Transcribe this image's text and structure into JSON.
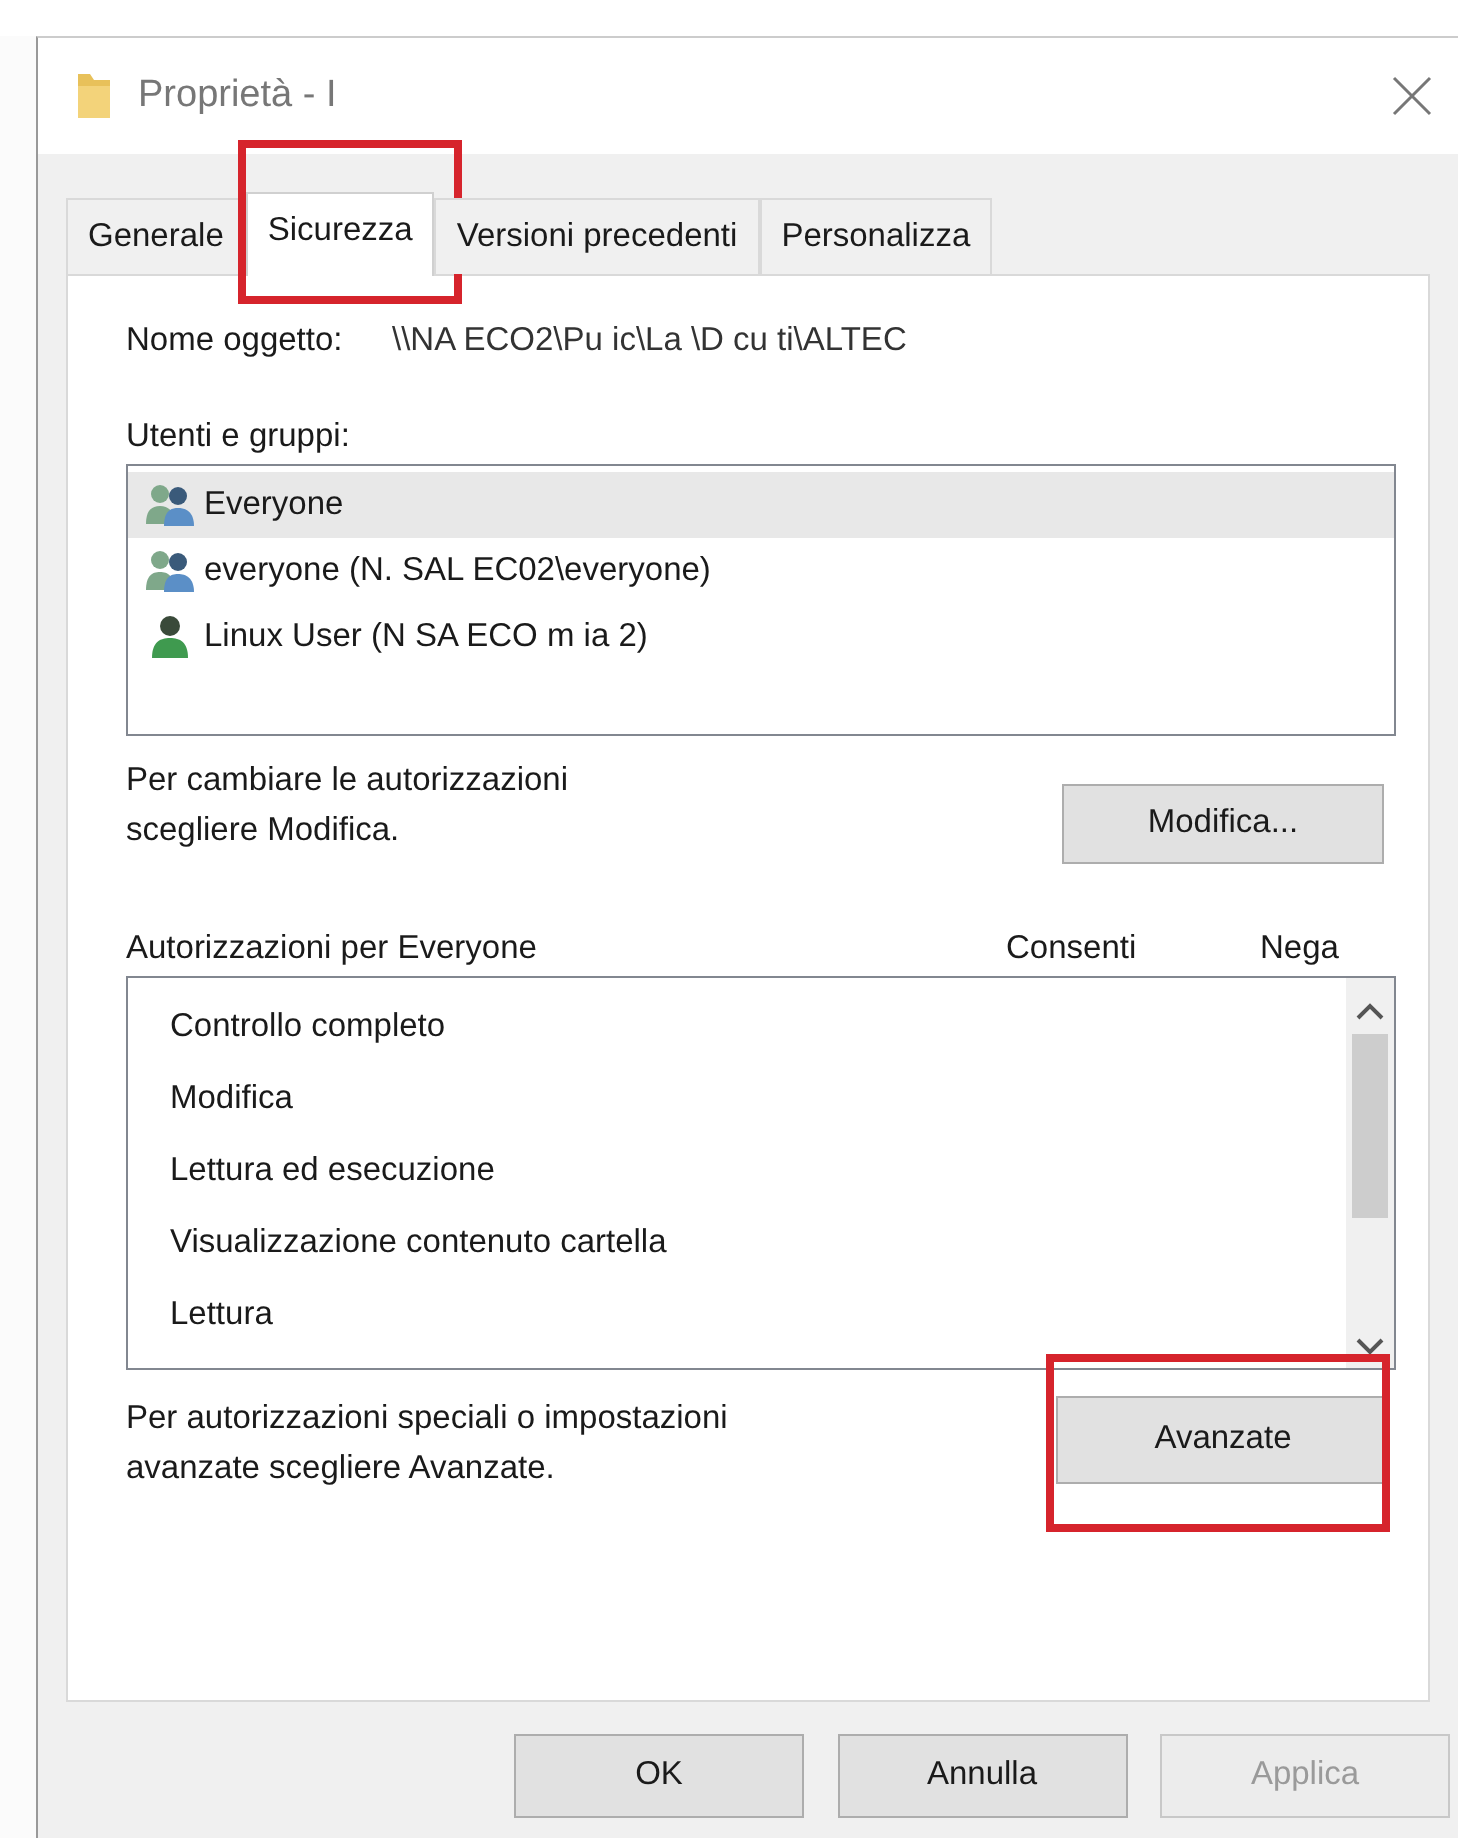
{
  "window": {
    "title": "Proprietà - I"
  },
  "tabs": [
    {
      "label": "Generale",
      "selected": false,
      "highlighted": false
    },
    {
      "label": "Sicurezza",
      "selected": true,
      "highlighted": true
    },
    {
      "label": "Versioni precedenti",
      "selected": false,
      "highlighted": false
    },
    {
      "label": "Personalizza",
      "selected": false,
      "highlighted": false
    }
  ],
  "object_name": {
    "label": "Nome oggetto:",
    "value": "\\\\NA  ECO2\\Pu ic\\La   \\D cu  ti\\ALTEC"
  },
  "users": {
    "label": "Utenti e gruppi:",
    "items": [
      {
        "name": "Everyone",
        "kind": "group",
        "selected": true
      },
      {
        "name": "everyone (N. SAL  EC02\\everyone)",
        "kind": "group",
        "selected": false
      },
      {
        "name": "Linux User (N SA  ECO  m  ia    2)",
        "kind": "user",
        "selected": false
      }
    ]
  },
  "change_hint": {
    "lines": [
      "Per cambiare le autorizzazioni",
      "scegliere Modifica."
    ],
    "button": "Modifica..."
  },
  "permissions": {
    "title": "Autorizzazioni per Everyone",
    "columns": [
      "Consenti",
      "Nega"
    ],
    "items": [
      "Controllo completo",
      "Modifica",
      "Lettura ed esecuzione",
      "Visualizzazione contenuto cartella",
      "Lettura"
    ]
  },
  "advanced": {
    "lines": [
      "Per autorizzazioni speciali o impostazioni",
      "avanzate scegliere Avanzate."
    ],
    "button": {
      "label": "Avanzate",
      "highlighted": true
    }
  },
  "buttons": [
    {
      "label": "OK",
      "disabled": false
    },
    {
      "label": "Annulla",
      "disabled": false
    },
    {
      "label": "Applica",
      "disabled": true
    }
  ]
}
